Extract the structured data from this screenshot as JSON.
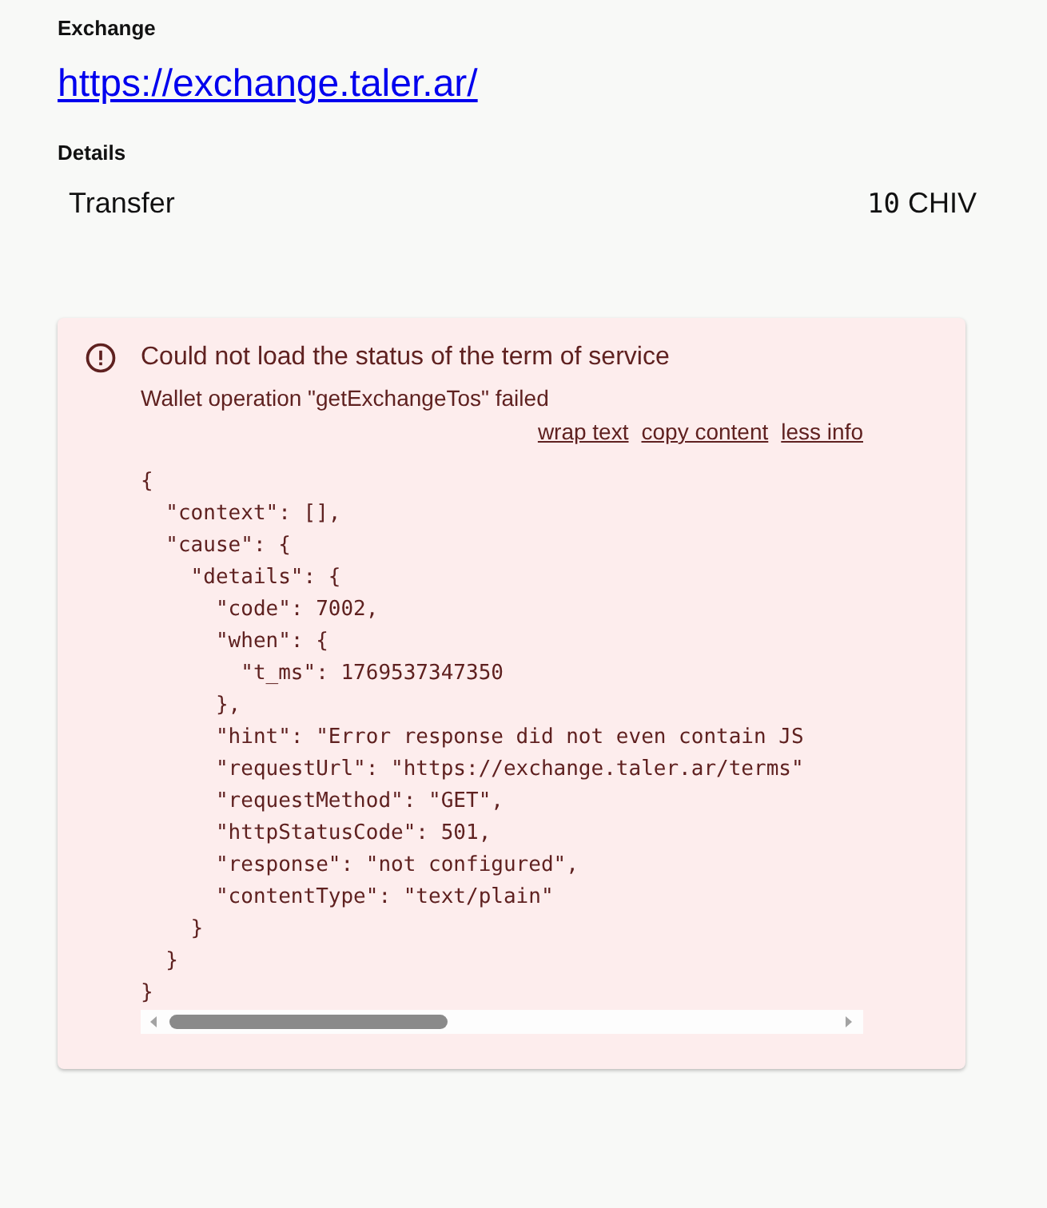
{
  "exchange": {
    "label": "Exchange",
    "url": "https://exchange.taler.ar/"
  },
  "details": {
    "label": "Details",
    "rows": [
      {
        "name": "Transfer",
        "amount": "10",
        "currency": "CHIV"
      }
    ]
  },
  "error": {
    "title": "Could not load the status of the term of service",
    "message": "Wallet operation \"getExchangeTos\" failed",
    "links": [
      "wrap text",
      "copy content",
      "less info"
    ],
    "code_lines": [
      "{",
      "  \"context\": [],",
      "  \"cause\": {",
      "    \"details\": {",
      "      \"code\": 7002,",
      "      \"when\": {",
      "        \"t_ms\": 1769537347350",
      "      },",
      "      \"hint\": \"Error response did not even contain JS",
      "      \"requestUrl\": \"https://exchange.taler.ar/terms\"",
      "      \"requestMethod\": \"GET\",",
      "      \"httpStatusCode\": 501,",
      "      \"response\": \"not configured\",",
      "      \"contentType\": \"text/plain\"",
      "    }",
      "  }",
      "}"
    ]
  }
}
